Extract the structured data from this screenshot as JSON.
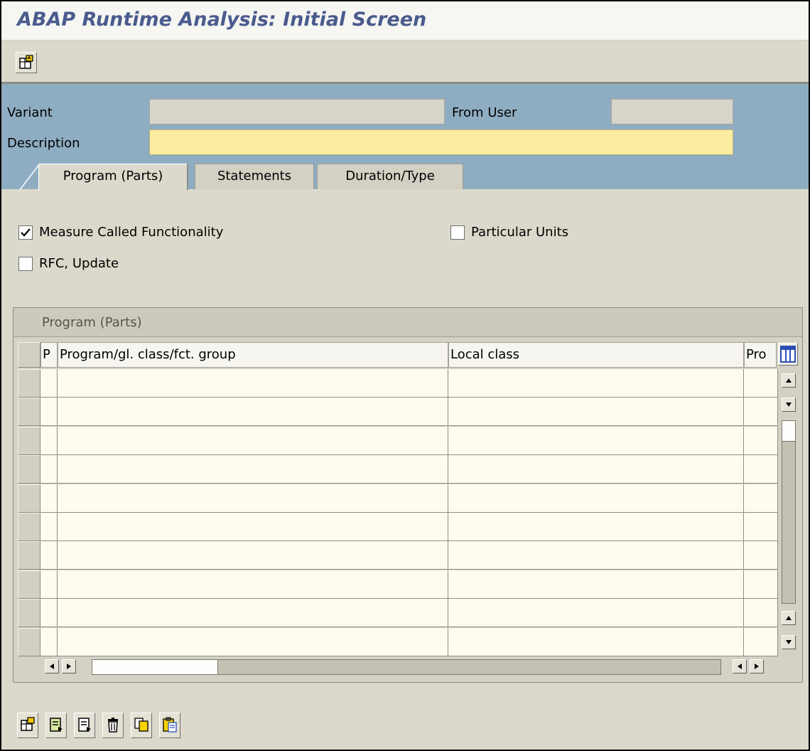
{
  "window": {
    "title": "ABAP Runtime Analysis: Initial Screen"
  },
  "toolbar": {
    "buttons": [
      {
        "icon": "create-variant-icon"
      }
    ]
  },
  "header": {
    "variant": {
      "label": "Variant",
      "value": ""
    },
    "from_user": {
      "label": "From User",
      "value": ""
    },
    "description": {
      "label": "Description",
      "value": ""
    }
  },
  "tabs": [
    {
      "label": "Program (Parts)",
      "active": true
    },
    {
      "label": "Statements",
      "active": false
    },
    {
      "label": "Duration/Type",
      "active": false
    }
  ],
  "options": {
    "measure_called": {
      "label": "Measure Called Functionality",
      "checked": true
    },
    "particular_units": {
      "label": "Particular Units",
      "checked": false
    },
    "rfc_update": {
      "label": "RFC, Update",
      "checked": false
    }
  },
  "grid": {
    "title": "Program (Parts)",
    "columns": [
      {
        "label": "P"
      },
      {
        "label": "Program/gl. class/fct. group"
      },
      {
        "label": "Local class"
      },
      {
        "label": "Pro"
      }
    ],
    "row_count": 10,
    "rows": []
  },
  "bottom_toolbar": {
    "buttons": [
      {
        "icon": "insert-row-icon"
      },
      {
        "icon": "append-row-icon"
      },
      {
        "icon": "insert-line-icon"
      },
      {
        "icon": "delete-row-icon"
      },
      {
        "icon": "copy-icon"
      },
      {
        "icon": "paste-icon"
      }
    ]
  },
  "colors": {
    "title_text": "#4a5b8e",
    "header_band": "#8eadc2",
    "required_field": "#fdeda0",
    "background": "#dcd9cc"
  }
}
